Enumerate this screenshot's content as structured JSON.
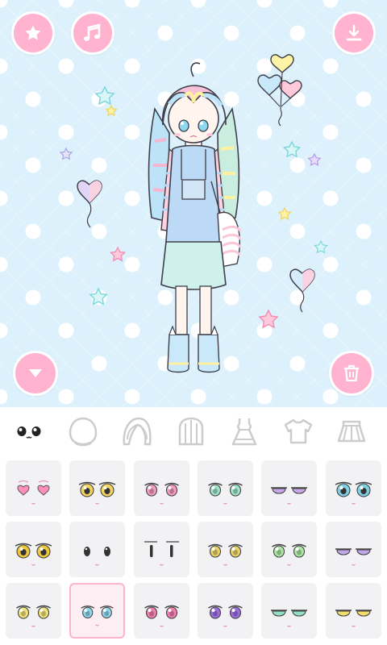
{
  "app": {
    "toolbar": {
      "favorite_icon": "star-icon",
      "music_icon": "music-note-icon",
      "save_icon": "download-icon",
      "collapse_icon": "chevron-down-icon",
      "delete_icon": "trash-icon"
    },
    "category_tabs": [
      {
        "id": "eyes",
        "icon": "eyes-icon",
        "selected": true
      },
      {
        "id": "face",
        "icon": "face-shape-icon",
        "selected": false
      },
      {
        "id": "front-hair",
        "icon": "front-hair-icon",
        "selected": false
      },
      {
        "id": "back-hair",
        "icon": "back-hair-icon",
        "selected": false
      },
      {
        "id": "dress",
        "icon": "dress-icon",
        "selected": false
      },
      {
        "id": "shirt",
        "icon": "shirt-icon",
        "selected": false
      },
      {
        "id": "skirt",
        "icon": "skirt-icon",
        "selected": false
      }
    ],
    "eye_options": [
      {
        "style": "heart",
        "iris": "#ff8fb8",
        "selected": false
      },
      {
        "style": "sparkle",
        "iris": "#f3d45e",
        "selected": false
      },
      {
        "style": "round",
        "iris": "#f59ec0",
        "selected": false
      },
      {
        "style": "round",
        "iris": "#9fe3c8",
        "selected": false
      },
      {
        "style": "half",
        "iris": "#c9a7ea",
        "selected": false
      },
      {
        "style": "big",
        "iris": "#7fcfe4",
        "selected": false
      },
      {
        "style": "anime",
        "iris": "#f0c63a",
        "selected": false
      },
      {
        "style": "dot",
        "iris": "#333333",
        "selected": false
      },
      {
        "style": "line",
        "iris": "#333333",
        "selected": false
      },
      {
        "style": "round",
        "iris": "#e8d36a",
        "selected": false
      },
      {
        "style": "round",
        "iris": "#aee6a6",
        "selected": false
      },
      {
        "style": "half",
        "iris": "#bfa6e8",
        "selected": false
      },
      {
        "style": "round",
        "iris": "#f2e27a",
        "selected": false
      },
      {
        "style": "round",
        "iris": "#8fd6ee",
        "selected": true
      },
      {
        "style": "round",
        "iris": "#f27fb0",
        "selected": false
      },
      {
        "style": "round",
        "iris": "#9c6fe0",
        "selected": false
      },
      {
        "style": "half",
        "iris": "#93e0c4",
        "selected": false
      },
      {
        "style": "half",
        "iris": "#f3de6a",
        "selected": false
      }
    ],
    "colors": {
      "pink_button": "#ffb3cf",
      "background": "#dcf1fc",
      "tab_icon": "#cccccc",
      "cell_bg": "#f2f2f4",
      "selected_border": "#ffb4cb"
    }
  }
}
